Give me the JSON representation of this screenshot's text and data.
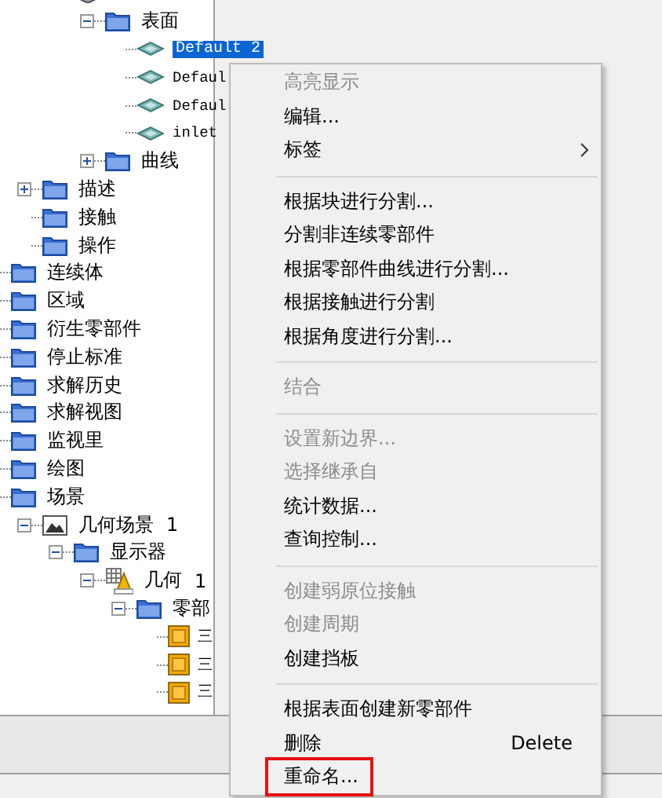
{
  "tree": [
    {
      "children": [
        {
          "children": [
            {
              "kind": "body",
              "children": [
                {
                  "label": "表面",
                  "kind": "folder",
                  "expanded": true,
                  "children": [
                    {
                      "label": "Default 2",
                      "kind": "surface",
                      "selected": true
                    },
                    {
                      "label": "Defaul",
                      "kind": "surface",
                      "selected": false
                    },
                    {
                      "label": "Defaul",
                      "kind": "surface",
                      "selected": false
                    },
                    {
                      "label": "inlet",
                      "kind": "surface",
                      "selected": false
                    }
                  ]
                },
                {
                  "label": "曲线",
                  "kind": "folder",
                  "expanded": false
                }
              ]
            }
          ]
        },
        {
          "label": "描述",
          "kind": "folder",
          "expanded": false
        },
        {
          "label": "接触",
          "kind": "folder"
        },
        {
          "label": "操作",
          "kind": "folder"
        }
      ]
    },
    {
      "label": "连续体",
      "kind": "folder"
    },
    {
      "label": "区域",
      "kind": "folder"
    },
    {
      "label": "衍生零部件",
      "kind": "folder"
    },
    {
      "label": "停止标准",
      "kind": "folder"
    },
    {
      "label": "求解历史",
      "kind": "folder"
    },
    {
      "label": "求解视图",
      "kind": "folder"
    },
    {
      "label": "监视里",
      "kind": "folder"
    },
    {
      "label": "绘图",
      "kind": "folder"
    },
    {
      "label": "场景",
      "kind": "folder",
      "children": [
        {
          "label": "几何场景",
          "count": "1",
          "kind": "scene",
          "expanded": true,
          "children": [
            {
              "label": "显示器",
              "kind": "folder",
              "expanded": true,
              "children": [
                {
                  "label": "几何",
                  "count": "1",
                  "kind": "geometry",
                  "expanded": true,
                  "children": [
                    {
                      "label": "零部",
                      "kind": "folder",
                      "expanded": true,
                      "children": [
                        {
                          "label": "三",
                          "kind": "part"
                        },
                        {
                          "label": "三",
                          "kind": "part"
                        },
                        {
                          "label": "三",
                          "kind": "part"
                        }
                      ]
                    }
                  ]
                }
              ]
            }
          ]
        }
      ]
    }
  ],
  "context_menu": [
    {
      "kind": "item",
      "label": "高亮显示",
      "disabled": true
    },
    {
      "kind": "item",
      "label": "编辑...",
      "disabled": false
    },
    {
      "kind": "item",
      "label": "标签",
      "disabled": false,
      "submenu": true
    },
    {
      "kind": "separator"
    },
    {
      "kind": "item",
      "label": "根据块进行分割...",
      "disabled": false
    },
    {
      "kind": "item",
      "label": "分割非连续零部件",
      "disabled": false
    },
    {
      "kind": "item",
      "label": "根据零部件曲线进行分割...",
      "disabled": false
    },
    {
      "kind": "item",
      "label": "根据接触进行分割",
      "disabled": false
    },
    {
      "kind": "item",
      "label": "根据角度进行分割...",
      "disabled": false
    },
    {
      "kind": "separator"
    },
    {
      "kind": "item",
      "label": "结合",
      "disabled": true
    },
    {
      "kind": "separator"
    },
    {
      "kind": "item",
      "label": "设置新边界...",
      "disabled": true
    },
    {
      "kind": "item",
      "label": "选择继承自",
      "disabled": true
    },
    {
      "kind": "item",
      "label": "统计数据...",
      "disabled": false
    },
    {
      "kind": "item",
      "label": "查询控制...",
      "disabled": false
    },
    {
      "kind": "separator"
    },
    {
      "kind": "item",
      "label": "创建弱原位接触",
      "disabled": true
    },
    {
      "kind": "item",
      "label": "创建周期",
      "disabled": true
    },
    {
      "kind": "item",
      "label": "创建挡板",
      "disabled": false
    },
    {
      "kind": "separator"
    },
    {
      "kind": "item",
      "label": "根据表面创建新零部件",
      "disabled": false
    },
    {
      "kind": "item",
      "label": "删除",
      "disabled": false,
      "shortcut": "Delete"
    },
    {
      "kind": "item",
      "label": "重命名...",
      "disabled": false,
      "highlighted": true
    }
  ]
}
